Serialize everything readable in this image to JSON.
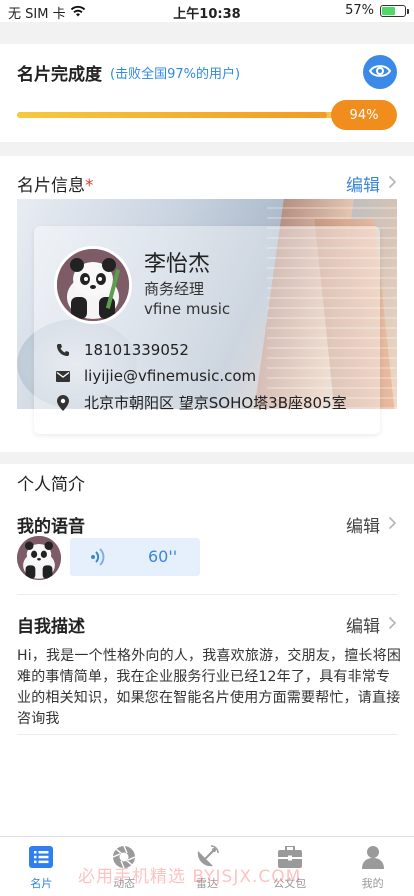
{
  "status_bar": {
    "carrier": "无 SIM 卡",
    "time": "上午10:38",
    "battery": "57%",
    "battery_level": 0.57
  },
  "completeness": {
    "title": "名片完成度",
    "subtitle": "(击败全国97%的用户)",
    "percent_label": "94%",
    "percent_value": 94
  },
  "card_info": {
    "title": "名片信息",
    "required_mark": "*",
    "edit_label": "编辑",
    "name": "李怡杰",
    "role": "商务经理",
    "company": "vfine music",
    "phone": "18101339052",
    "email": "liyijie@vfinemusic.com",
    "address": "北京市朝阳区 望京SOHO塔3B座805室"
  },
  "profile": {
    "title": "个人简介",
    "voice": {
      "title": "我的语音",
      "edit_label": "编辑",
      "duration": "60''"
    },
    "description": {
      "title": "自我描述",
      "edit_label": "编辑",
      "text": "Hi，我是一个性格外向的人，我喜欢旅游，交朋友，擅长将困难的事情简单，我在企业服务行业已经12年了，具有非常专业的相关知识，如果您在智能名片使用方面需要帮忙，请直接咨询我"
    }
  },
  "tabbar": {
    "items": [
      {
        "label": "名片",
        "icon": "card-list-icon",
        "active": true
      },
      {
        "label": "动态",
        "icon": "aperture-icon",
        "active": false
      },
      {
        "label": "雷达",
        "icon": "radar-dish-icon",
        "active": false
      },
      {
        "label": "公文包",
        "icon": "briefcase-icon",
        "active": false
      },
      {
        "label": "我的",
        "icon": "user-icon",
        "active": false
      }
    ]
  },
  "watermark": "必用手机精选 BYJSJX.COM",
  "colors": {
    "accent": "#2f7ff0",
    "progress": "#f18d1d",
    "edit_link": "#3a86d8",
    "required": "#e53935"
  }
}
